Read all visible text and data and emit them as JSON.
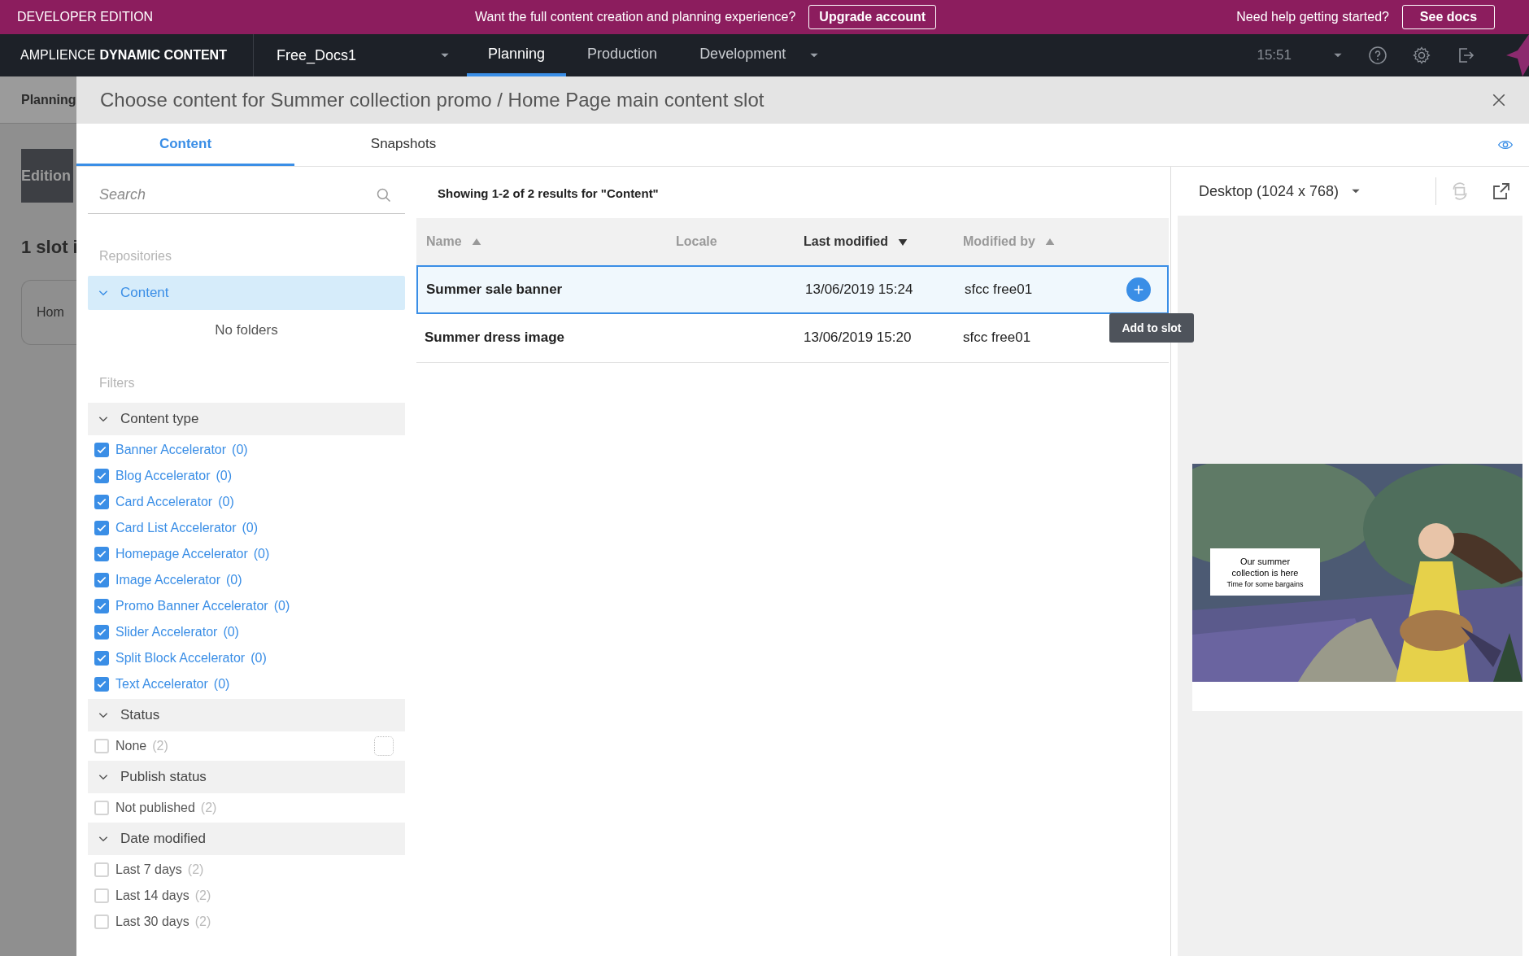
{
  "banner": {
    "edition": "DEVELOPER EDITION",
    "message": "Want the full content creation and planning experience?",
    "upgrade_button": "Upgrade account",
    "help_text": "Need help getting started?",
    "docs_button": "See docs"
  },
  "nav": {
    "brand_light": "AMPLIENCE",
    "brand_bold": "DYNAMIC CONTENT",
    "hub": "Free_Docs1",
    "tabs": [
      {
        "label": "Planning",
        "selected": true
      },
      {
        "label": "Production",
        "selected": false
      },
      {
        "label": "Development",
        "selected": false
      }
    ],
    "time": "15:51"
  },
  "background": {
    "breadcrumb": "Planning",
    "edition_label": "Edition",
    "slot_heading": "1 slot i",
    "slot_card": "Hom"
  },
  "dialog": {
    "title": "Choose content for Summer collection promo / Home Page main content slot",
    "tabs": [
      {
        "label": "Content",
        "selected": true
      },
      {
        "label": "Snapshots",
        "selected": false
      }
    ],
    "search": {
      "placeholder": "Search"
    },
    "repositories_heading": "Repositories",
    "repositories": [
      {
        "label": "Content",
        "selected": true,
        "expanded": true
      }
    ],
    "no_folders": "No folders",
    "filters_heading": "Filters",
    "filter_groups": [
      {
        "title": "Content type",
        "expanded": true,
        "options": [
          {
            "label": "Banner Accelerator",
            "count": "(0)",
            "checked": true
          },
          {
            "label": "Blog Accelerator",
            "count": "(0)",
            "checked": true
          },
          {
            "label": "Card Accelerator",
            "count": "(0)",
            "checked": true
          },
          {
            "label": "Card List Accelerator",
            "count": "(0)",
            "checked": true
          },
          {
            "label": "Homepage Accelerator",
            "count": "(0)",
            "checked": true
          },
          {
            "label": "Image Accelerator",
            "count": "(0)",
            "checked": true
          },
          {
            "label": "Promo Banner Accelerator",
            "count": "(0)",
            "checked": true
          },
          {
            "label": "Slider Accelerator",
            "count": "(0)",
            "checked": true
          },
          {
            "label": "Split Block Accelerator",
            "count": "(0)",
            "checked": true
          },
          {
            "label": "Text Accelerator",
            "count": "(0)",
            "checked": true
          }
        ]
      },
      {
        "title": "Status",
        "expanded": true,
        "options": [
          {
            "label": "None",
            "count": "(2)",
            "checked": false
          }
        ]
      },
      {
        "title": "Publish status",
        "expanded": true,
        "options": [
          {
            "label": "Not published",
            "count": "(2)",
            "checked": false
          }
        ]
      },
      {
        "title": "Date modified",
        "expanded": true,
        "options": [
          {
            "label": "Last 7 days",
            "count": "(2)",
            "checked": false
          },
          {
            "label": "Last 14 days",
            "count": "(2)",
            "checked": false
          },
          {
            "label": "Last 30 days",
            "count": "(2)",
            "checked": false
          }
        ]
      }
    ],
    "results_summary": "Showing 1-2 of 2 results for \"Content\"",
    "table": {
      "columns": [
        {
          "label": "Name",
          "sorted": true,
          "ascending": true,
          "active": false
        },
        {
          "label": "Locale",
          "sorted": false,
          "active": false
        },
        {
          "label": "Last modified",
          "sorted": true,
          "ascending": false,
          "active": true
        },
        {
          "label": "Modified by",
          "sorted": true,
          "ascending": true,
          "active": false
        }
      ],
      "rows": [
        {
          "name": "Summer sale banner",
          "last_modified": "13/06/2019 15:24",
          "modified_by": "sfcc free01",
          "selected": true
        },
        {
          "name": "Summer dress image",
          "last_modified": "13/06/2019 15:20",
          "modified_by": "sfcc free01",
          "selected": false
        }
      ]
    },
    "tooltip": "Add to slot",
    "preview": {
      "device": "Desktop (1024 x 768)",
      "banner_heading": "Our summer collection is here",
      "banner_subtext": "Time for some bargains"
    }
  }
}
